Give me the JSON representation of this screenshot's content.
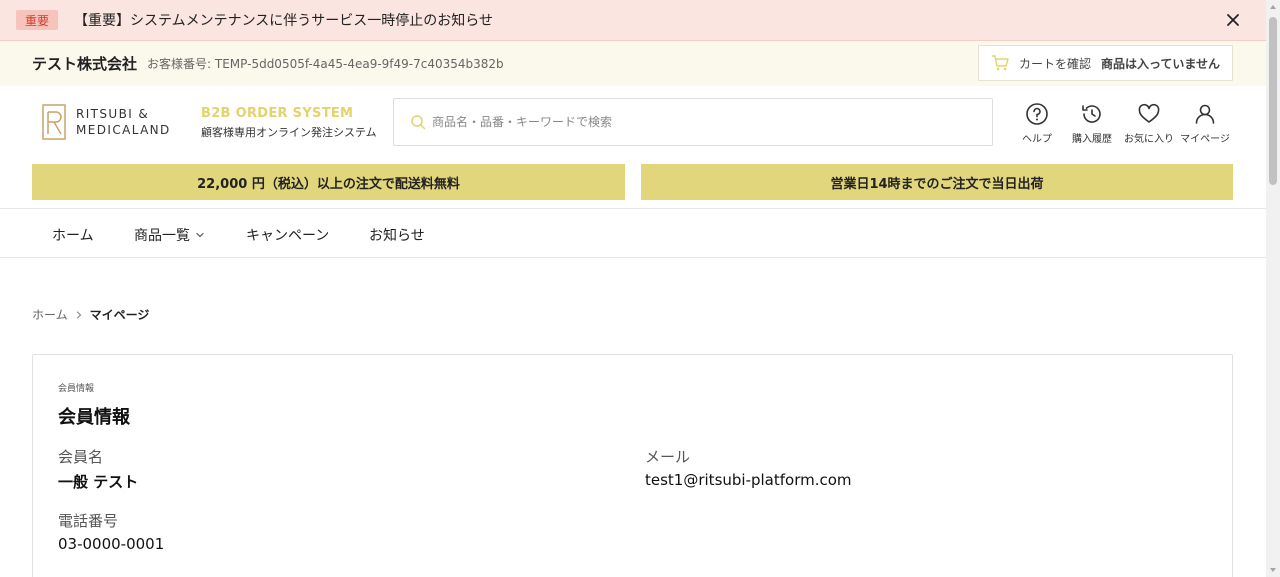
{
  "alert": {
    "badge": "重要",
    "message": "【重要】システムメンテナンスに伴うサービス一時停止のお知らせ"
  },
  "account": {
    "company": "テスト株式会社",
    "customer_number": "お客様番号: TEMP-5dd0505f-4a45-4ea9-9f49-7c40354b382b",
    "cart_label": "カートを確認",
    "cart_status": "商品は入っていません"
  },
  "brand": {
    "logo_line1": "RITSUBI &",
    "logo_line2": "MEDICALAND",
    "system_title": "B2B ORDER SYSTEM",
    "system_subtitle": "顧客様専用オンライン発注システム",
    "accent_color": "#e2d67c"
  },
  "search": {
    "placeholder": "商品名・品番・キーワードで検索"
  },
  "header_icons": {
    "help": "ヘルプ",
    "history": "購入履歴",
    "favorites": "お気に入り",
    "mypage": "マイページ"
  },
  "promos": {
    "shipping": "22,000 円（税込）以上の注文で配送料無料",
    "sameday": "営業日14時までのご注文で当日出荷"
  },
  "nav": {
    "home": "ホーム",
    "products": "商品一覧",
    "campaign": "キャンペーン",
    "news": "お知らせ"
  },
  "breadcrumb": {
    "home": "ホーム",
    "current": "マイページ"
  },
  "member": {
    "eyebrow": "会員情報",
    "title": "会員情報",
    "name_label": "会員名",
    "name_value": "一般 テスト",
    "email_label": "メール",
    "email_value": "test1@ritsubi-platform.com",
    "phone_label": "電話番号",
    "phone_value": "03-0000-0001"
  }
}
